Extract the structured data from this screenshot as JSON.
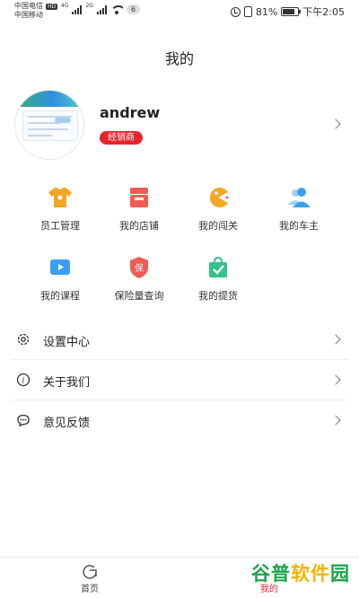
{
  "status_bar": {
    "carrier_1": "中国电信",
    "hd_badge": "HD",
    "carrier_2": "中国移动",
    "net_1": "4G",
    "net_2": "2G",
    "notification_count": "6",
    "battery_percent": "81%",
    "battery_level": 0.81,
    "time": "下午2:05"
  },
  "header": {
    "title": "我的"
  },
  "profile": {
    "username": "andrew",
    "role_badge": "经销商"
  },
  "grid": {
    "items": [
      {
        "label": "员工管理",
        "icon": "tshirt-icon",
        "color": "#f5a623"
      },
      {
        "label": "我的店铺",
        "icon": "shop-icon",
        "color": "#f25c54"
      },
      {
        "label": "我的闯关",
        "icon": "pacman-icon",
        "color": "#f5a623"
      },
      {
        "label": "我的车主",
        "icon": "users-icon",
        "color": "#3a9ff2"
      },
      {
        "label": "我的课程",
        "icon": "video-play-icon",
        "color": "#3a9ff2"
      },
      {
        "label": "保险量查询",
        "icon": "insurance-shield-icon",
        "icon_text": "保",
        "color": "#f25c54"
      },
      {
        "label": "我的提货",
        "icon": "shopping-bag-check-icon",
        "color": "#36c28a"
      }
    ]
  },
  "menu": {
    "items": [
      {
        "label": "设置中心",
        "icon": "gear-icon"
      },
      {
        "label": "关于我们",
        "icon": "info-icon"
      },
      {
        "label": "意见反馈",
        "icon": "chat-icon"
      }
    ]
  },
  "bottom_nav": {
    "home_label": "首页",
    "mine_label": "我的"
  },
  "watermark": {
    "part_1": "谷普",
    "part_2": "软件",
    "part_3": "园"
  }
}
